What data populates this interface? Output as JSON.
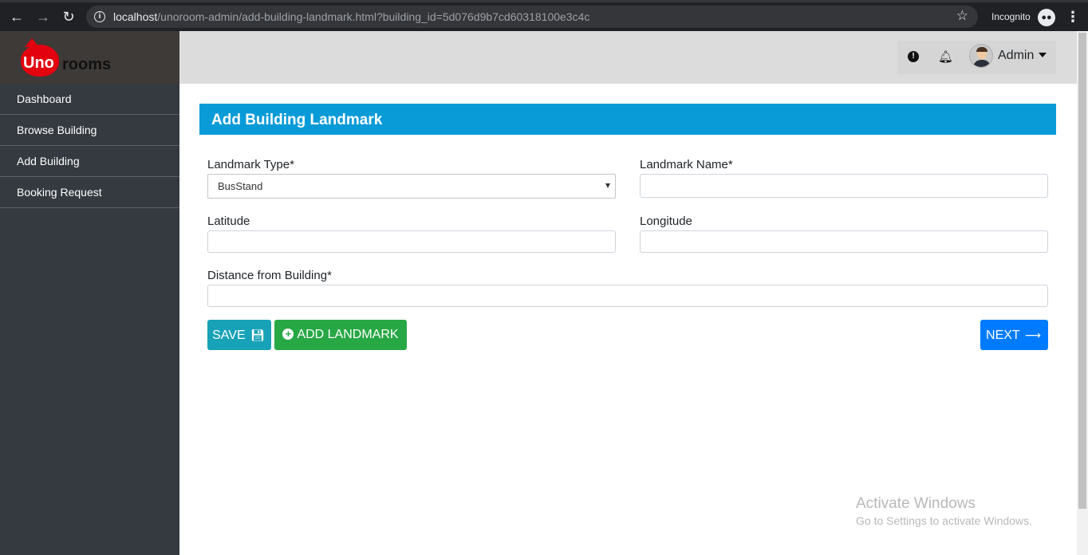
{
  "browser": {
    "url_host": "localhost",
    "url_path": "/unoroom-admin/add-building-landmark.html?building_id=5d076d9b7cd60318100e3c4c",
    "incognito_label": "Incognito"
  },
  "brand": {
    "logo_part1": "Uno",
    "logo_part2": "rooms",
    "color": "#e3000f"
  },
  "sidebar": {
    "items": [
      {
        "label": "Dashboard"
      },
      {
        "label": "Browse Building"
      },
      {
        "label": "Add Building"
      },
      {
        "label": "Booking Request"
      }
    ]
  },
  "topbar": {
    "user_label": "Admin"
  },
  "page": {
    "title": "Add Building Landmark",
    "header_color": "#089bd8"
  },
  "form": {
    "landmark_type": {
      "label": "Landmark Type*",
      "value": "BusStand"
    },
    "landmark_name": {
      "label": "Landmark Name*",
      "value": ""
    },
    "latitude": {
      "label": "Latitude",
      "value": ""
    },
    "longitude": {
      "label": "Longitude",
      "value": ""
    },
    "distance": {
      "label": "Distance from Building*",
      "value": ""
    }
  },
  "buttons": {
    "save": "SAVE",
    "add_landmark": "ADD LANDMARK",
    "next": "NEXT"
  },
  "watermark": {
    "title": "Activate Windows",
    "subtitle": "Go to Settings to activate Windows."
  }
}
